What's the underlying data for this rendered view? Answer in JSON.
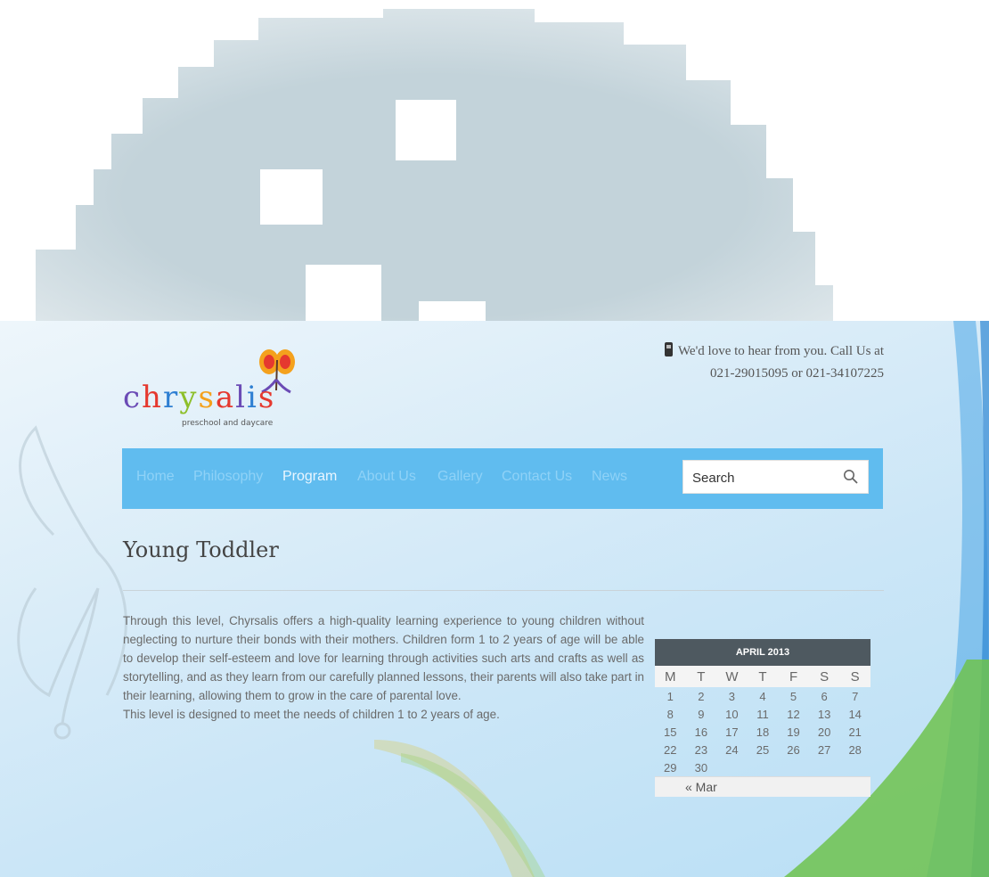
{
  "header": {
    "callout_line1": "We'd love to hear from you. Call Us at",
    "callout_line2": "021-29015095 or 021-34107225"
  },
  "logo": {
    "word": "chrysalis",
    "tagline": "preschool and daycare"
  },
  "nav": {
    "items": [
      {
        "label": "Home"
      },
      {
        "label": "Philosophy"
      },
      {
        "label": "Program"
      },
      {
        "label": "About Us"
      },
      {
        "label": "Gallery"
      },
      {
        "label": "Contact Us"
      },
      {
        "label": "News"
      }
    ],
    "active": "Program",
    "search_placeholder": "Search"
  },
  "page": {
    "title": "Young Toddler",
    "paragraph1": "Through this level, Chyrsalis offers a high-quality learning experience to young children without neglecting to nurture their bonds with their mothers. Children form 1 to 2 years of age will be able to develop their self-esteem and love for learning through activities such arts and crafts as well as storytelling, and as they learn from our carefully planned lessons, their parents will also take part in their learning, allowing them to grow in the care of parental love.",
    "paragraph2": "This level is designed to meet the needs of children 1 to 2 years of age."
  },
  "calendar": {
    "caption": "APRIL 2013",
    "weekdays": [
      "M",
      "T",
      "W",
      "T",
      "F",
      "S",
      "S"
    ],
    "weeks": [
      [
        "1",
        "2",
        "3",
        "4",
        "5",
        "6",
        "7"
      ],
      [
        "8",
        "9",
        "10",
        "11",
        "12",
        "13",
        "14"
      ],
      [
        "15",
        "16",
        "17",
        "18",
        "19",
        "20",
        "21"
      ],
      [
        "22",
        "23",
        "24",
        "25",
        "26",
        "27",
        "28"
      ],
      [
        "29",
        "30",
        "",
        "",
        "",
        "",
        ""
      ]
    ],
    "prev_link": "« Mar"
  },
  "colors": {
    "nav_bar": "#60bcef",
    "nav_text": "#8fd2f7",
    "calendar_header": "#4e5960",
    "house_graphic": "#c3d3da"
  }
}
